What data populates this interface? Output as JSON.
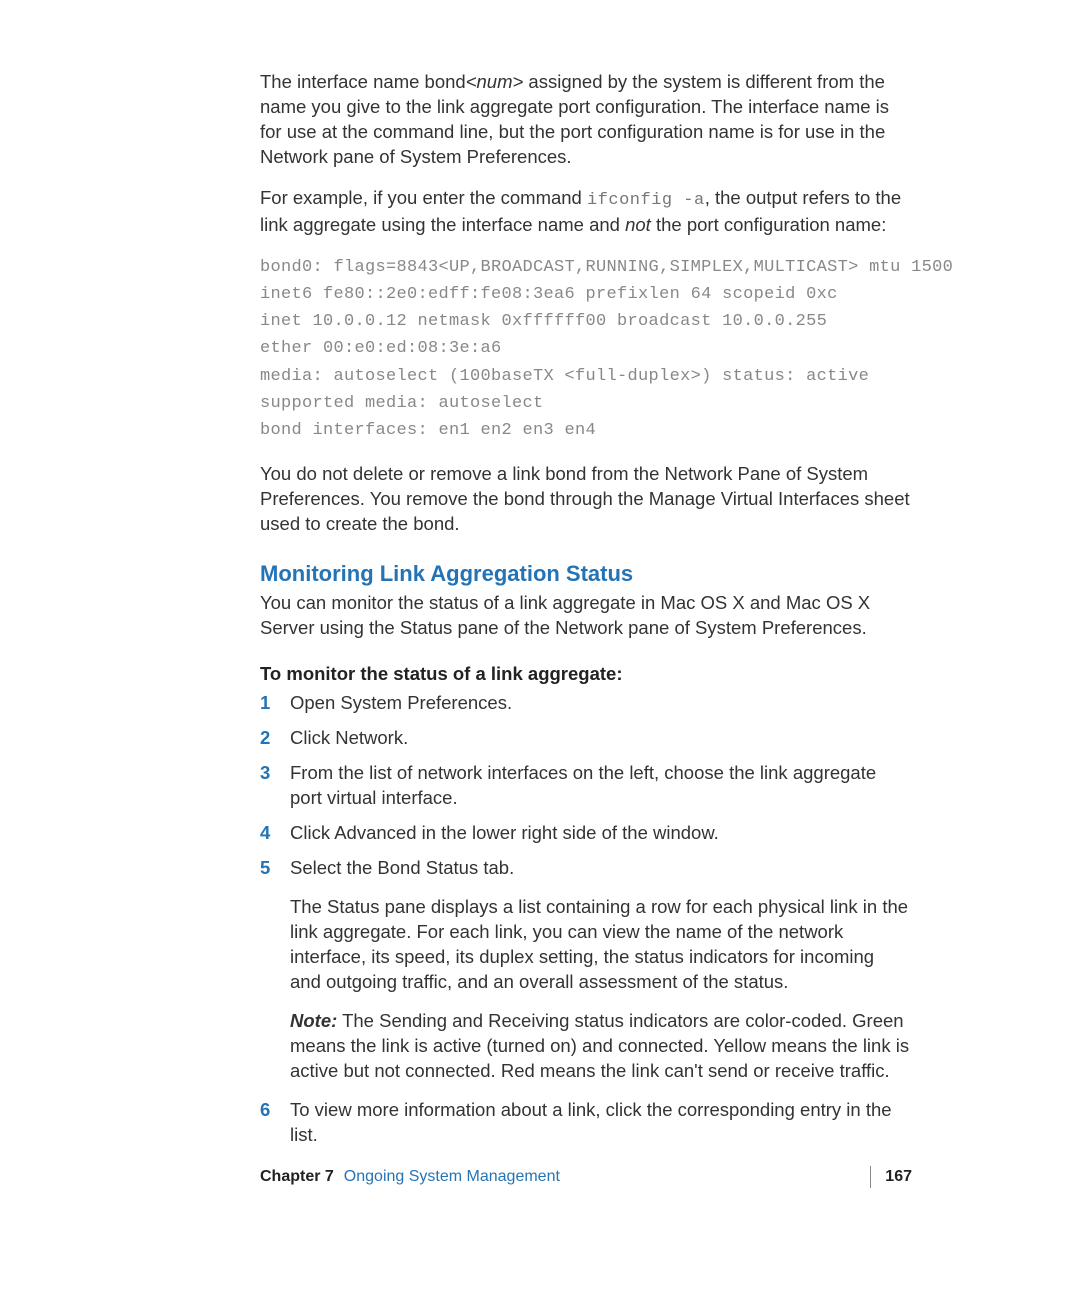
{
  "para1_a": "The interface name bond",
  "para1_b": "<num>",
  "para1_c": " assigned by the system is different from the name you give to the link aggregate port configuration. The interface name is for use at the command line, but the port configuration name is for use in the Network pane of System Preferences.",
  "para2_a": "For example, if you enter the command ",
  "para2_cmd": "ifconfig -a",
  "para2_b": ", the output refers to the link aggregate using the interface name and ",
  "para2_not": "not",
  "para2_c": " the port configuration name:",
  "code": {
    "l1": "bond0: flags=8843<UP,BROADCAST,RUNNING,SIMPLEX,MULTICAST> mtu 1500",
    "l2": "inet6 fe80::2e0:edff:fe08:3ea6 prefixlen 64 scopeid 0xc",
    "l3": "inet 10.0.0.12 netmask 0xffffff00 broadcast 10.0.0.255",
    "l4": "ether 00:e0:ed:08:3e:a6",
    "l5": "media: autoselect (100baseTX <full-duplex>) status: active",
    "l6": "supported media: autoselect",
    "l7": "bond interfaces: en1 en2 en3 en4"
  },
  "para3": "You do not delete or remove a link bond from the Network Pane of System Preferences. You remove the bond through the Manage Virtual Interfaces sheet used to create the bond.",
  "heading": "Monitoring Link Aggregation Status",
  "para4": "You can monitor the status of a link aggregate in Mac OS X and Mac OS X Server using the Status pane of the Network pane of System Preferences.",
  "steps_title": "To monitor the status of a link aggregate:",
  "steps": {
    "s1": "Open System Preferences.",
    "s2": "Click Network.",
    "s3": "From the list of network interfaces on the left, choose the link aggregate port virtual interface.",
    "s4": "Click Advanced in the lower right side of the window.",
    "s5": "Select the Bond Status tab.",
    "s6": "To view more information about a link, click the corresponding entry in the list."
  },
  "sub5a": "The Status pane displays a list containing a row for each physical link in the link aggregate. For each link, you can view the name of the network interface, its speed, its duplex setting, the status indicators for incoming and outgoing traffic, and an overall assessment of the status.",
  "sub5b_note": "Note:",
  "sub5b_text": "  The Sending and Receiving status indicators are color-coded. Green means the link is active (turned on) and connected. Yellow means the link is active but not connected. Red means the link can't send or receive traffic.",
  "footer": {
    "chapter_label": "Chapter 7",
    "chapter_title": "Ongoing System Management",
    "page_number": "167"
  }
}
